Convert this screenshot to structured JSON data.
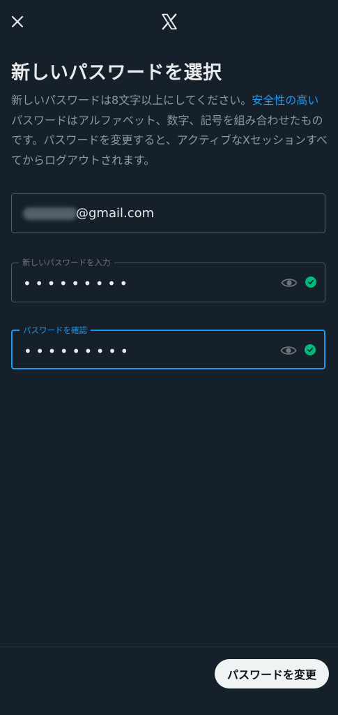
{
  "header": {
    "close_icon": "close-icon",
    "logo_icon": "x-logo-icon"
  },
  "page": {
    "title": "新しいパスワードを選択",
    "description_before": "新しいパスワードは8文字以上にしてください。",
    "description_link": "安全性の高い",
    "description_after": "パスワードはアルファベット、数字、記号を組み合わせたものです。パスワードを変更すると、アクティブなXセッションすべてからログアウトされます。"
  },
  "form": {
    "email_suffix": "@gmail.com",
    "new_password_label": "新しいパスワードを入力",
    "new_password_value": "•••••••••",
    "confirm_password_label": "パスワードを確認",
    "confirm_password_value": "•••••••••",
    "show_password_icon": "eye-icon",
    "valid_icon": "check-circle-icon"
  },
  "footer": {
    "submit_label": "パスワードを変更"
  },
  "colors": {
    "background": "#15202b",
    "accent": "#1d9bf0",
    "success": "#00ba7c"
  }
}
